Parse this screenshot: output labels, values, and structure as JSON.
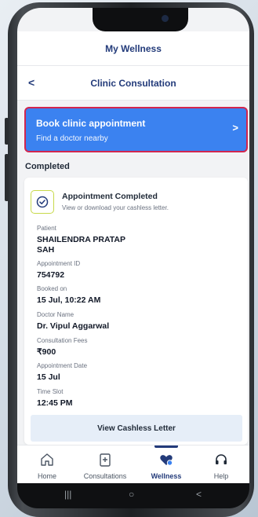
{
  "app_header": {
    "title": "My Wellness"
  },
  "sub_header": {
    "back": "<",
    "title": "Clinic Consultation"
  },
  "book_card": {
    "title": "Book clinic appointment",
    "subtitle": "Find a doctor nearby",
    "chevron": ">"
  },
  "section": {
    "label": "Completed"
  },
  "appointment": {
    "status_title": "Appointment Completed",
    "status_subtitle": "View or download your cashless letter.",
    "fields": [
      {
        "label": "Patient",
        "value": "SHAILENDRA PRATAP\nSAH"
      },
      {
        "label": "Appointment ID",
        "value": "754792"
      },
      {
        "label": "Booked on",
        "value": "15 Jul, 10:22 AM"
      },
      {
        "label": "Doctor Name",
        "value": "Dr. Vipul Aggarwal"
      },
      {
        "label": "Consultation Fees",
        "value": "₹900"
      },
      {
        "label": "Appointment Date",
        "value": "15 Jul"
      },
      {
        "label": "Time Slot",
        "value": "12:45 PM"
      }
    ],
    "button": "View Cashless Letter"
  },
  "bottom_nav": {
    "items": [
      {
        "label": "Home",
        "icon": "home-icon"
      },
      {
        "label": "Consultations",
        "icon": "medical-file-icon"
      },
      {
        "label": "Wellness",
        "icon": "heart-icon"
      },
      {
        "label": "Help",
        "icon": "headset-icon"
      }
    ],
    "active": "Wellness"
  },
  "system_bar": {
    "recents": "|||",
    "home": "○",
    "back": "<"
  },
  "colors": {
    "brand_navy": "#233b7a",
    "book_blue": "#3b82f0",
    "highlight_border": "#d1264f",
    "status_green": "#c7d94a",
    "button_bg": "#e6eef8"
  }
}
